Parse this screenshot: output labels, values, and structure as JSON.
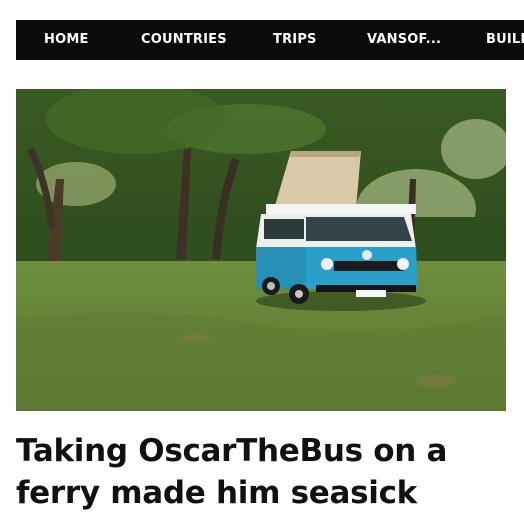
{
  "nav": {
    "items": [
      {
        "label": "HOME"
      },
      {
        "label": "COUNTRIES"
      },
      {
        "label": "TRIPS"
      },
      {
        "label": "VANSOF..."
      },
      {
        "label": "BUILD"
      }
    ]
  },
  "article": {
    "title": "Taking OscarTheBus on a ferry made him seasick",
    "image_alt_subject": "van-in-park-photo"
  },
  "colors": {
    "nav_bg": "#0b0b0b",
    "nav_text": "#ffffff",
    "title_text": "#111111",
    "van_body": "#2a9fc9"
  }
}
